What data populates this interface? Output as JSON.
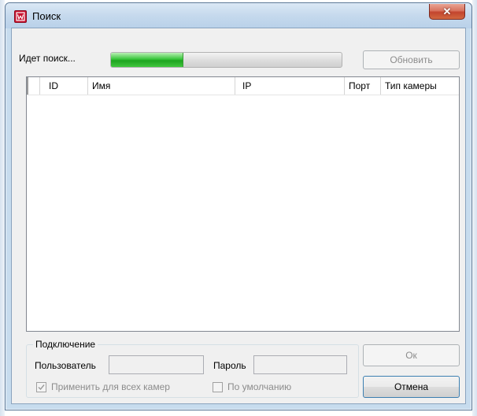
{
  "window": {
    "title": "Поиск",
    "close_glyph": "✕"
  },
  "search": {
    "status_label": "Идет поиск...",
    "progress_fraction": 0.31,
    "refresh_label": "Обновить"
  },
  "table": {
    "columns": [
      "",
      "ID",
      "Имя",
      "IP",
      "Порт",
      "Тип камеры"
    ],
    "rows": []
  },
  "connection": {
    "group_title": "Подключение",
    "user_label": "Пользователь",
    "user_value": "",
    "password_label": "Пароль",
    "password_value": "",
    "apply_all_label": "Применить для всех камер",
    "apply_all_checked": true,
    "default_label": "По умолчанию",
    "default_checked": false
  },
  "buttons": {
    "ok_label": "Ок",
    "cancel_label": "Отмена"
  },
  "colors": {
    "progress_green": "#1ea31f",
    "close_red": "#c2452e",
    "app_icon_red": "#c8102e"
  },
  "icons": {
    "app": "camera-app-icon",
    "close": "close-icon",
    "check": "checkmark-icon"
  }
}
